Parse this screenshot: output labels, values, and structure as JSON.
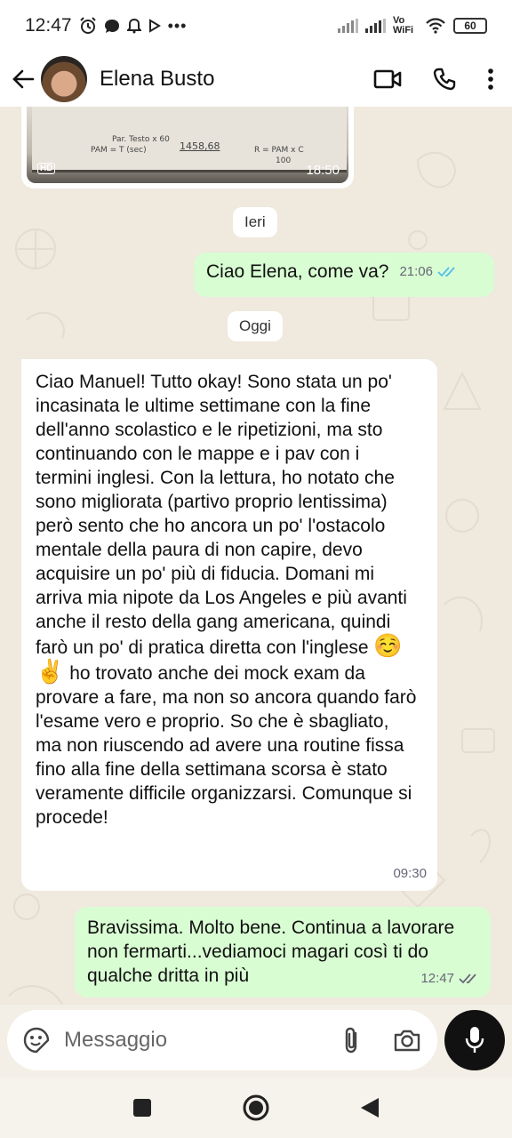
{
  "status_bar": {
    "time": "12:47",
    "network_label": "Vo WiFi",
    "battery": "60",
    "more": "•••"
  },
  "header": {
    "contact_name": "Elena Busto"
  },
  "image_message": {
    "time": "18:50",
    "hd_label": "HD",
    "formula_pam": "PAM = T (sec)",
    "formula_parole": "Par. Testo x 60",
    "formula_value": "1458,68",
    "formula_r": "R = PAM x C",
    "formula_r_den": "100"
  },
  "day_separators": {
    "yesterday": "Ieri",
    "today": "Oggi"
  },
  "messages": [
    {
      "direction": "outgoing",
      "text": "Ciao Elena, come va?",
      "time": "21:06",
      "status": "read"
    },
    {
      "direction": "incoming",
      "text_part1": "Ciao Manuel! Tutto okay! Sono stata un po' incasinata le ultime settimane con la fine dell'anno scolastico e le ripetizioni, ma sto continuando con le mappe e i pav con i termini inglesi. Con la lettura, ho notato che sono migliorata (partivo proprio lentissima) però sento che ho ancora un po' l'ostacolo mentale della paura di non capire, devo acquisire un po' più di fiducia. Domani mi arriva mia nipote da Los Angeles e più avanti anche il resto della gang americana, quindi farò un po' di pratica diretta con l'inglese",
      "emoji1": "☺️",
      "emoji2": "✌️",
      "text_part2": "ho trovato anche dei mock exam da provare a fare, ma non so ancora quando farò l'esame vero e proprio. So che è sbagliato, ma non riuscendo ad avere una routine fissa fino alla fine della settimana scorsa è stato veramente difficile organizzarsi. Comunque si procede!",
      "time": "09:30"
    },
    {
      "direction": "outgoing",
      "text": "Bravissima. Molto bene. Continua a lavorare non fermarti...vediamoci magari così ti do qualche dritta in più",
      "time": "12:47",
      "status": "delivered"
    }
  ],
  "composer": {
    "placeholder": "Messaggio"
  },
  "colors": {
    "outgoing_bubble": "#d9fdd3",
    "incoming_bubble": "#ffffff",
    "read_ticks": "#53bdeb",
    "chat_background": "#efe9de"
  }
}
